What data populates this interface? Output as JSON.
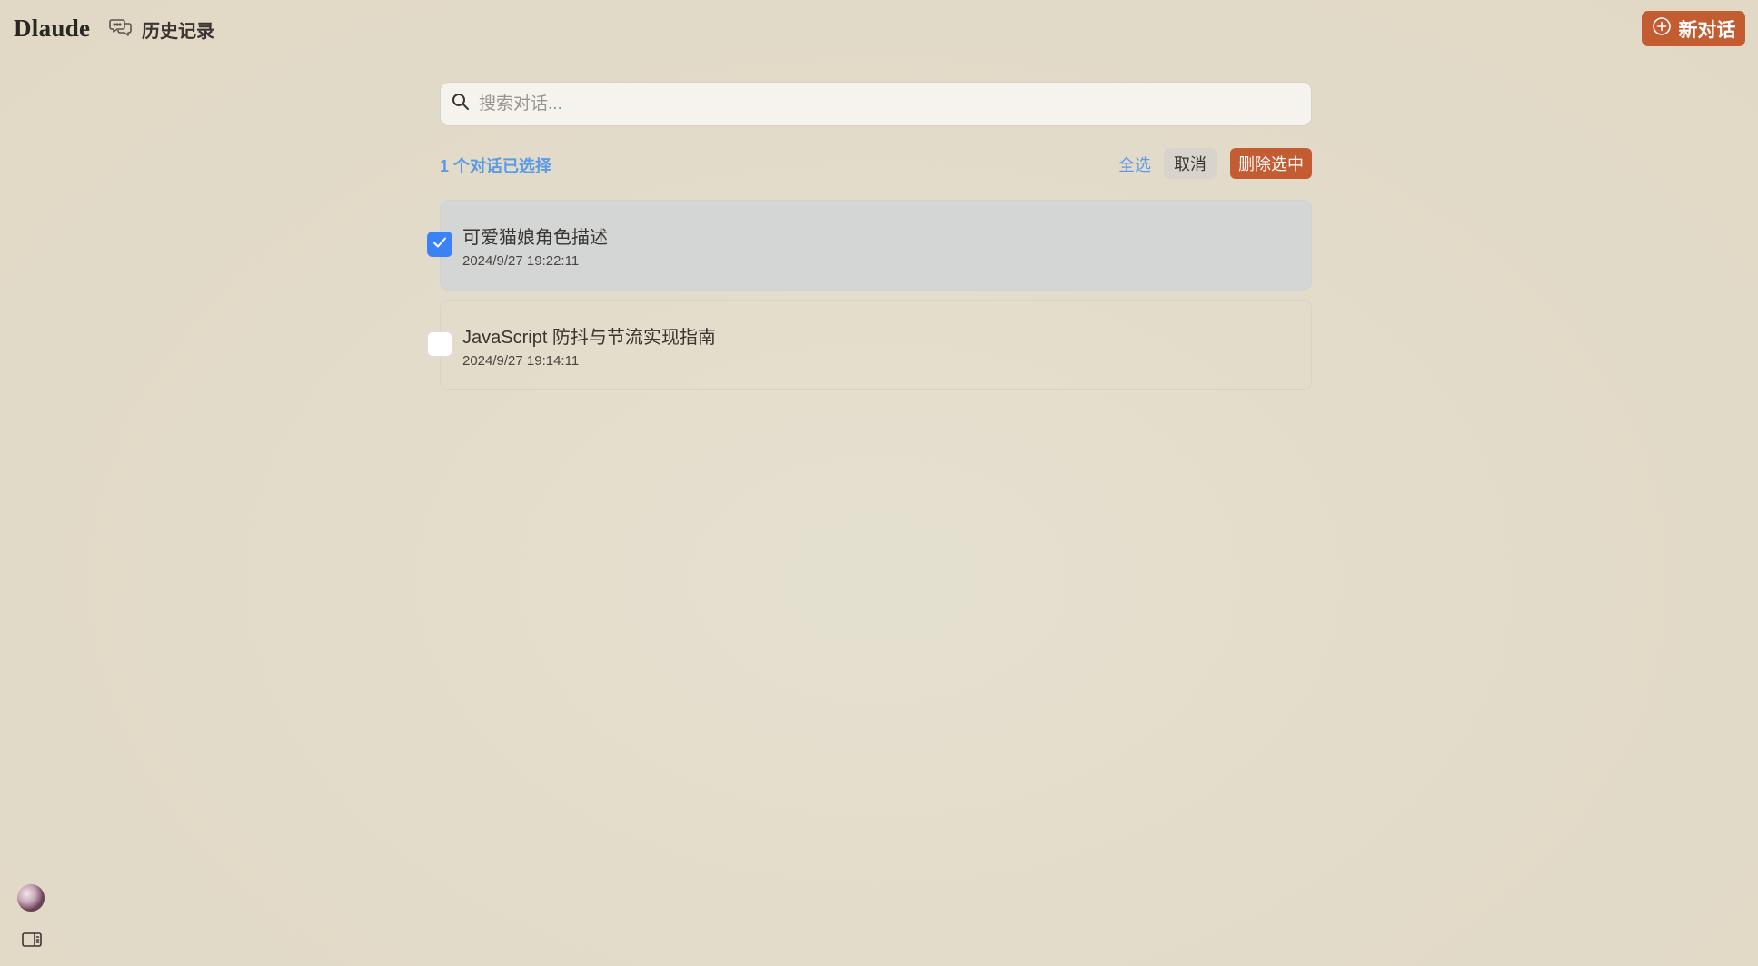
{
  "header": {
    "brand": "Dlaude",
    "history_label": "历史记录",
    "new_chat_label": "新对话"
  },
  "search": {
    "placeholder": "搜索对话..."
  },
  "selection": {
    "count_text": "1 个对话已选择",
    "select_all_label": "全选",
    "cancel_label": "取消",
    "delete_label": "删除选中"
  },
  "conversations": [
    {
      "title": "可爱猫娘角色描述",
      "timestamp": "2024/9/27 19:22:11",
      "checked": true
    },
    {
      "title": "JavaScript 防抖与节流实现指南",
      "timestamp": "2024/9/27 19:14:11",
      "checked": false
    }
  ],
  "colors": {
    "accent": "#c45c32",
    "link_blue": "#5a9ae6",
    "checkbox_blue": "#3b82f6",
    "background": "#e3dbc9"
  },
  "icons": {
    "history": "chat-bubbles-icon",
    "new_chat": "plus-circle-icon",
    "search": "search-icon",
    "check": "checkmark-icon",
    "sidebar": "sidebar-toggle-icon",
    "avatar": "user-avatar"
  }
}
